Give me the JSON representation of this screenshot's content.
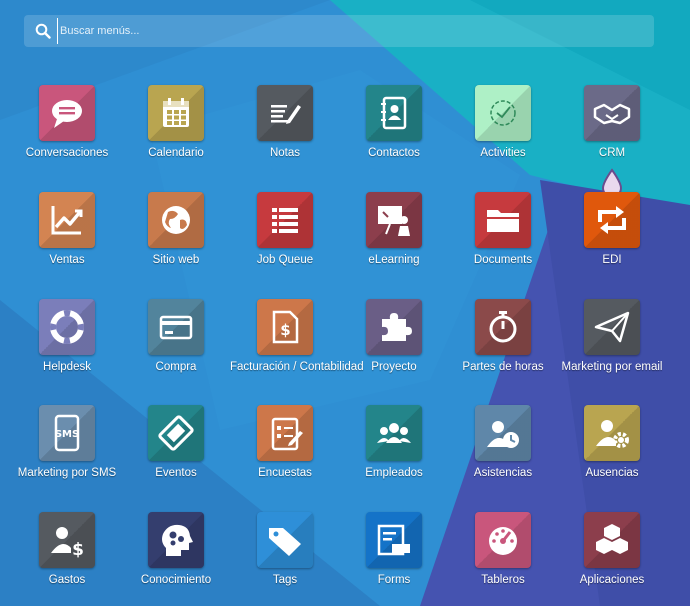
{
  "search": {
    "placeholder": "Buscar menús..."
  },
  "colors": {
    "bg_blue": "#2f8fd3",
    "bg_teal": "#16b4c4",
    "bg_indigo": "#4a55b4"
  },
  "apps": [
    {
      "label": "Conversaciones",
      "icon": "chat-icon",
      "color": "#c9567c"
    },
    {
      "label": "Calendario",
      "icon": "calendar-icon",
      "color": "#b9a550"
    },
    {
      "label": "Notas",
      "icon": "notes-icon",
      "color": "#555a60"
    },
    {
      "label": "Contactos",
      "icon": "contacts-icon",
      "color": "#23858a"
    },
    {
      "label": "Activities",
      "icon": "activities-icon",
      "color": "#aef0c6"
    },
    {
      "label": "CRM",
      "icon": "handshake-icon",
      "color": "#6b6a88"
    },
    {
      "label": "Ventas",
      "icon": "chart-icon",
      "color": "#d38452"
    },
    {
      "label": "Sitio web",
      "icon": "globe-icon",
      "color": "#c87a4c"
    },
    {
      "label": "Job Queue",
      "icon": "list-icon",
      "color": "#c63a3e"
    },
    {
      "label": "eLearning",
      "icon": "presentation-icon",
      "color": "#8c3e4c"
    },
    {
      "label": "Documents",
      "icon": "folder-icon",
      "color": "#c63a3e"
    },
    {
      "label": "EDI",
      "icon": "sync-icon",
      "color": "#e0580c"
    },
    {
      "label": "Helpdesk",
      "icon": "lifebuoy-icon",
      "color": "#7b7eba"
    },
    {
      "label": "Compra",
      "icon": "credit-card-icon",
      "color": "#52849c"
    },
    {
      "label": "Facturación / Contabilidad",
      "icon": "invoice-icon",
      "color": "#cd774a"
    },
    {
      "label": "Proyecto",
      "icon": "puzzle-icon",
      "color": "#6a5e86"
    },
    {
      "label": "Partes de horas",
      "icon": "stopwatch-icon",
      "color": "#8b4a4a"
    },
    {
      "label": "Marketing por email",
      "icon": "paper-plane-icon",
      "color": "#555a60"
    },
    {
      "label": "Marketing por SMS",
      "icon": "sms-phone-icon",
      "color": "#6b8eae"
    },
    {
      "label": "Eventos",
      "icon": "ticket-icon",
      "color": "#23858a"
    },
    {
      "label": "Encuestas",
      "icon": "survey-icon",
      "color": "#cd774a"
    },
    {
      "label": "Empleados",
      "icon": "people-icon",
      "color": "#23858a"
    },
    {
      "label": "Asistencias",
      "icon": "user-clock-icon",
      "color": "#5f87a9"
    },
    {
      "label": "Ausencias",
      "icon": "user-gear-icon",
      "color": "#b9a550"
    },
    {
      "label": "Gastos",
      "icon": "user-dollar-icon",
      "color": "#555a60"
    },
    {
      "label": "Conocimiento",
      "icon": "head-gears-icon",
      "color": "#343e6e"
    },
    {
      "label": "Tags",
      "icon": "tags-icon",
      "color": "#2e8fd8"
    },
    {
      "label": "Forms",
      "icon": "form-icon",
      "color": "#1473c8"
    },
    {
      "label": "Tableros",
      "icon": "gauge-icon",
      "color": "#c9567c"
    },
    {
      "label": "Aplicaciones",
      "icon": "cubes-icon",
      "color": "#8c3e4c"
    }
  ]
}
